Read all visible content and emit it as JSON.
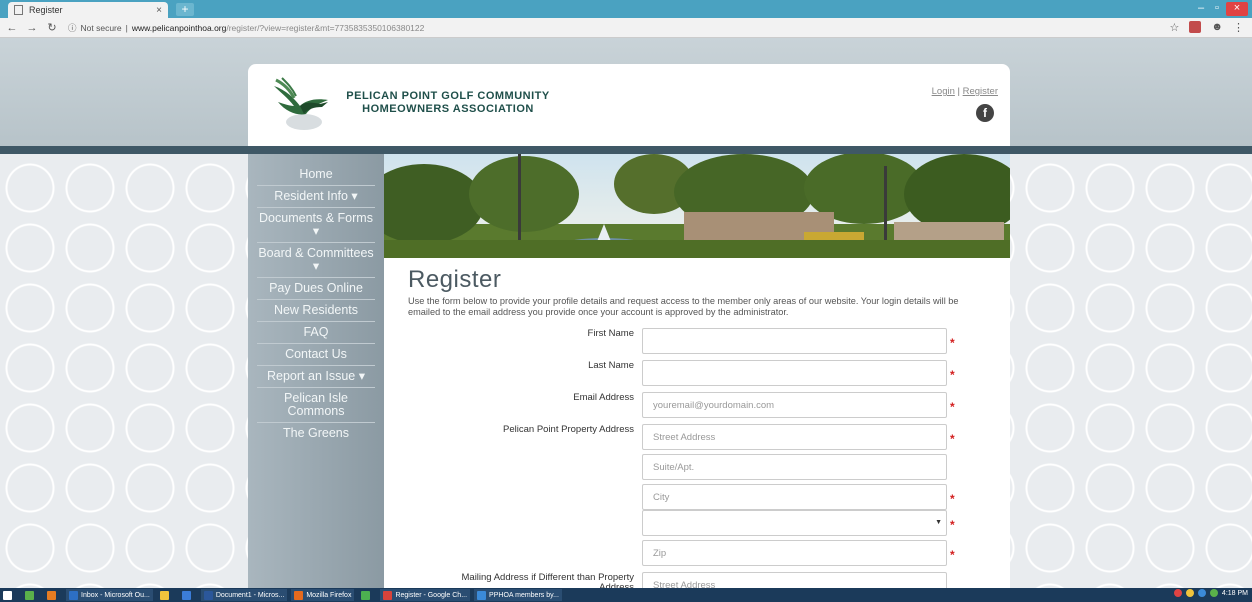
{
  "browser": {
    "tab_title": "Register",
    "tab_close": "×",
    "new_tab": "+",
    "security": "Not secure",
    "url_domain": "www.pelicanpointhoa.org",
    "url_path": "/register/?view=register&mt=7735835350106380122",
    "win_min": "–",
    "win_max": "▫",
    "win_close": "×"
  },
  "header": {
    "site_name_line1": "PELICAN POINT GOLF COMMUNITY",
    "site_name_line2": "HOMEOWNERS ASSOCIATION",
    "login": "Login",
    "separator": "|",
    "register": "Register",
    "facebook": "f"
  },
  "sidebar": {
    "items": [
      {
        "label": "Home"
      },
      {
        "label": "Resident Info ▾"
      },
      {
        "label": "Documents & Forms ▾"
      },
      {
        "label": "Board & Committees ▾"
      },
      {
        "label": "Pay Dues Online"
      },
      {
        "label": "New Residents"
      },
      {
        "label": "FAQ"
      },
      {
        "label": "Contact Us"
      },
      {
        "label": "Report an Issue ▾"
      },
      {
        "label": "Pelican Isle Commons"
      },
      {
        "label": "The Greens"
      }
    ]
  },
  "main": {
    "title": "Register",
    "intro": "Use the form below to provide your profile details and request access to the member only areas of our website. Your login details will be emailed to the email address you provide once your account is approved by the administrator.",
    "required_mark": "*",
    "fields": {
      "first_name_label": "First Name",
      "last_name_label": "Last Name",
      "email_label": "Email Address",
      "email_placeholder": "youremail@yourdomain.com",
      "property_label": "Pelican Point Property Address",
      "street_placeholder": "Street Address",
      "suite_placeholder": "Suite/Apt.",
      "city_placeholder": "City",
      "zip_placeholder": "Zip",
      "mailing_label": "Mailing Address if Different than Property Address",
      "mailing_street_placeholder": "Street Address"
    }
  },
  "taskbar": {
    "items": [
      {
        "label": "Inbox - Microsoft Ou..."
      },
      {
        "label": "Document1 - Micros..."
      },
      {
        "label": "Mozilla Firefox"
      },
      {
        "label": "Register - Google Ch..."
      },
      {
        "label": "PPHOA members by..."
      }
    ],
    "clock": "4:18 PM"
  }
}
